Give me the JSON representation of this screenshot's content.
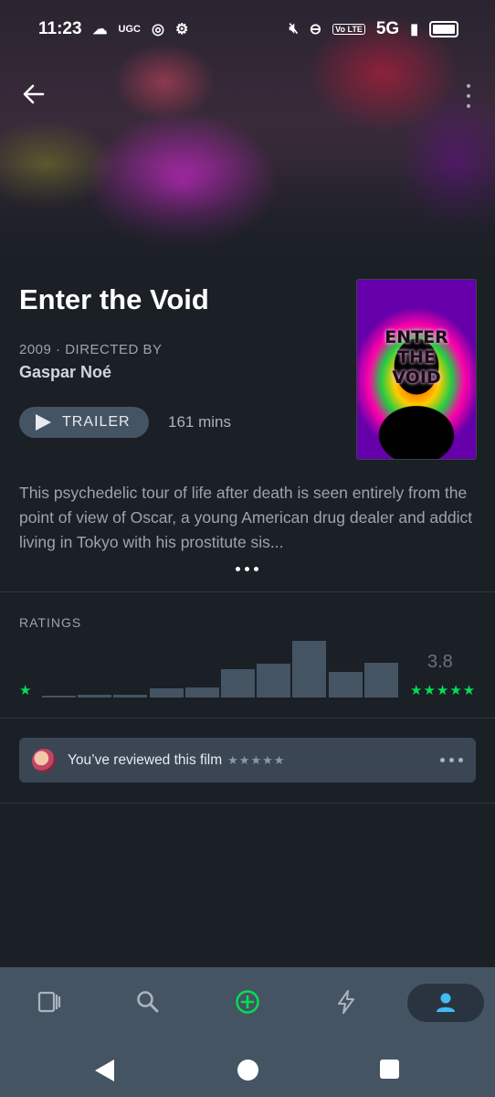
{
  "status_bar": {
    "time": "11:23",
    "ugc": "UGC",
    "network": "5G",
    "volte": "Vo LTE"
  },
  "film": {
    "title": "Enter the Void",
    "year": "2009",
    "directed_by_label": "DIRECTED BY",
    "director": "Gaspar Noé",
    "trailer_label": "TRAILER",
    "runtime": "161 mins",
    "poster_text": [
      "ENTER",
      "THE",
      "VOID"
    ],
    "synopsis": "This psychedelic tour of life after death is seen entirely from the point of view of Oscar, a young American drug dealer and addict living in Tokyo with his prostitute sis..."
  },
  "ratings": {
    "label": "RATINGS",
    "average": "3.8",
    "low_star": "★",
    "high_stars": "★★★★★",
    "histogram_relative": [
      0.03,
      0.05,
      0.05,
      0.16,
      0.18,
      0.5,
      0.6,
      1.0,
      0.45,
      0.62
    ]
  },
  "review": {
    "text": "You’ve reviewed this film",
    "stars": "★★★★★"
  },
  "tabs": [
    {
      "name": "films",
      "icon": "films-icon"
    },
    {
      "name": "search",
      "icon": "search-icon"
    },
    {
      "name": "add",
      "icon": "add-icon"
    },
    {
      "name": "activity",
      "icon": "lightning-icon"
    },
    {
      "name": "profile",
      "icon": "profile-icon",
      "active": true
    }
  ],
  "colors": {
    "accent_green": "#00e054",
    "background": "#1b1f26",
    "bar": "#455463"
  }
}
